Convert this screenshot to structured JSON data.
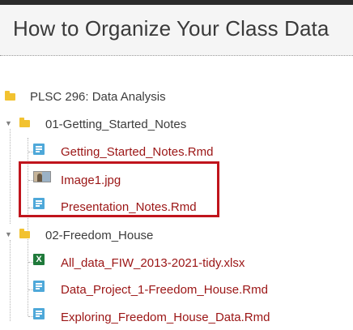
{
  "header": {
    "title": "How to Organize Your Class Data"
  },
  "tree": {
    "root": {
      "label": "PLSC 296: Data Analysis",
      "icon": "folder-icon"
    },
    "folders": [
      {
        "label": "01-Getting_Started_Notes",
        "expanded": true,
        "files": [
          {
            "label": "Getting_Started_Notes.Rmd",
            "icon": "document-icon"
          },
          {
            "label": "Image1.jpg",
            "icon": "image-thumbnail-icon",
            "highlighted": true
          },
          {
            "label": "Presentation_Notes.Rmd",
            "icon": "document-icon",
            "highlighted": true
          }
        ]
      },
      {
        "label": "02-Freedom_House",
        "expanded": true,
        "files": [
          {
            "label": "All_data_FIW_2013-2021-tidy.xlsx",
            "icon": "excel-icon"
          },
          {
            "label": "Data_Project_1-Freedom_House.Rmd",
            "icon": "document-icon"
          },
          {
            "label": "Exploring_Freedom_House_Data.Rmd",
            "icon": "document-icon"
          }
        ]
      }
    ]
  },
  "colors": {
    "file_link": "#9b1515",
    "folder": "#f2c230",
    "doc_icon": "#4ea8d9",
    "excel_icon": "#1f7a3a",
    "highlight_box": "#c0141c"
  }
}
